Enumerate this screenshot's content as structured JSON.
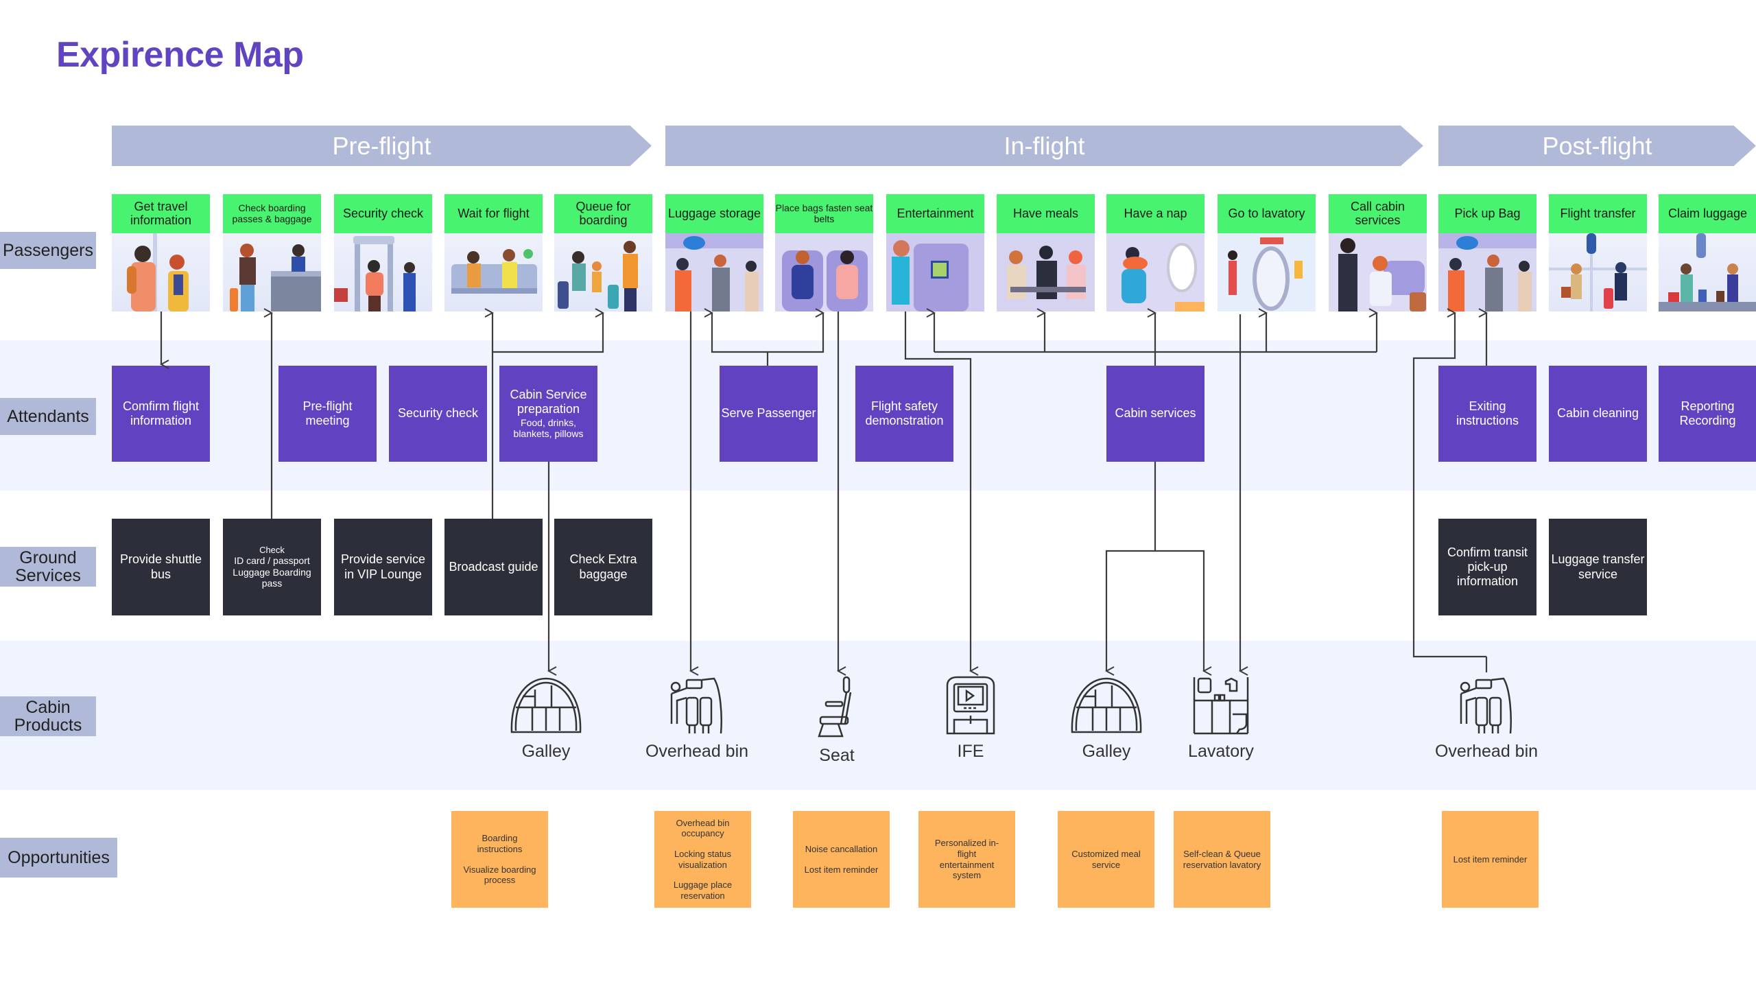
{
  "title": "Expirence Map",
  "phases": [
    "Pre-flight",
    "In-flight",
    "Post-flight"
  ],
  "colors": {
    "title": "#6144c2",
    "phase": "#b1b9d8",
    "passenger_header": "#48f46f",
    "attendant": "#6143c2",
    "ground": "#2c2e3a",
    "opportunity": "#fdb45c",
    "band": "#f0f4fe",
    "connector": "#3c3c3c"
  },
  "row_labels": {
    "passengers": "Passengers",
    "attendants": "Attendants",
    "ground_1": "Ground",
    "ground_2": "Services",
    "cabin_1": "Cabin",
    "cabin_2": "Products",
    "opportunities": "Opportunities"
  },
  "passengers": [
    {
      "label": "Get travel information",
      "illustration": "travellers-with-phone"
    },
    {
      "label": "Check boarding passes & baggage",
      "illustration": "check-in-counter"
    },
    {
      "label": "Security check",
      "illustration": "metal-detector-gate"
    },
    {
      "label": "Wait for flight",
      "illustration": "waiting-seats"
    },
    {
      "label": "Queue for boarding",
      "illustration": "family-with-luggage"
    },
    {
      "label": "Luggage storage",
      "illustration": "overhead-bin-stowing"
    },
    {
      "label": "Place bags fasten seat belts",
      "illustration": "seated-passengers-belts"
    },
    {
      "label": "Entertainment",
      "illustration": "seatback-screen"
    },
    {
      "label": "Have meals",
      "illustration": "passengers-eating"
    },
    {
      "label": "Have a nap",
      "illustration": "sleeping-passenger"
    },
    {
      "label": "Go to lavatory",
      "illustration": "lavatory-door"
    },
    {
      "label": "Call cabin services",
      "illustration": "attendant-serving"
    },
    {
      "label": "Pick up Bag",
      "illustration": "overhead-bin-retrieving"
    },
    {
      "label": "Flight transfer",
      "illustration": "travellers-walking"
    },
    {
      "label": "Claim luggage",
      "illustration": "baggage-carousel"
    }
  ],
  "attendants": [
    {
      "label": "Comfirm flight information"
    },
    {
      "label": "Pre-flight meeting"
    },
    {
      "label": "Security check"
    },
    {
      "label": "Cabin Service preparation",
      "sub": "Food, drinks, blankets, pillows"
    },
    {
      "label": "Serve Passenger"
    },
    {
      "label": "Flight safety demonstration"
    },
    {
      "label": "Cabin services"
    },
    {
      "label": "Exiting instructions"
    },
    {
      "label": "Cabin cleaning"
    },
    {
      "label": "Reporting Recording"
    }
  ],
  "ground_services": [
    {
      "label": "Provide shuttle bus"
    },
    {
      "label": "Check",
      "sub": "ID card / passport Luggage Boarding pass"
    },
    {
      "label": "Provide service in VIP Lounge"
    },
    {
      "label": "Broadcast guide"
    },
    {
      "label": "Check Extra baggage"
    },
    {
      "label": "Confirm transit pick-up information"
    },
    {
      "label": "Luggage transfer service"
    }
  ],
  "cabin_products": [
    {
      "label": "Galley",
      "icon": "galley-icon"
    },
    {
      "label": "Overhead bin",
      "icon": "overhead-bin-icon"
    },
    {
      "label": "Seat",
      "icon": "seat-icon"
    },
    {
      "label": "IFE",
      "icon": "ife-screen-icon"
    },
    {
      "label": "Galley",
      "icon": "galley-icon"
    },
    {
      "label": "Lavatory",
      "icon": "lavatory-icon"
    },
    {
      "label": "Overhead bin",
      "icon": "overhead-bin-icon"
    }
  ],
  "opportunities": [
    {
      "items": [
        "Boarding instructions",
        "Visualize boarding process"
      ]
    },
    {
      "items": [
        "Overhead bin occupancy",
        "Locking status visualization",
        "Luggage place reservation"
      ]
    },
    {
      "items": [
        "Noise cancallation",
        "Lost item reminder"
      ]
    },
    {
      "items": [
        "Personalized in-flight entertainment system"
      ]
    },
    {
      "items": [
        "Customized meal service"
      ]
    },
    {
      "items": [
        "Self-clean & Queue reservation lavatory"
      ]
    },
    {
      "items": [
        "Lost item reminder"
      ]
    }
  ]
}
